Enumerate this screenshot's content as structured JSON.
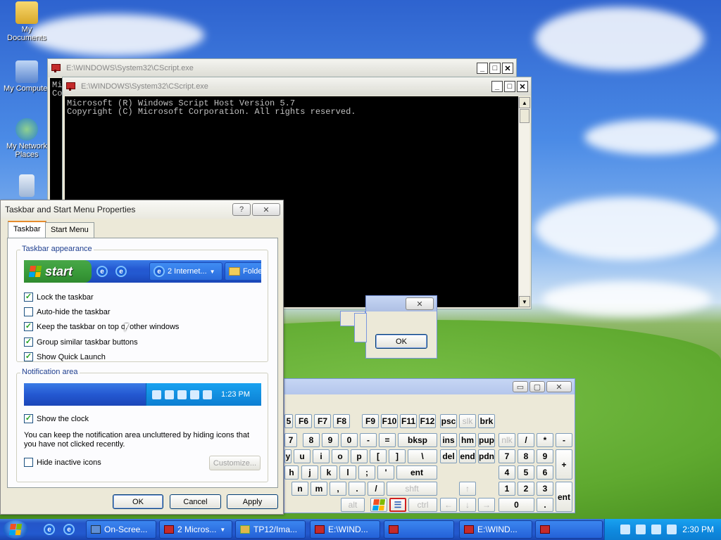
{
  "desktop": {
    "icons": [
      {
        "label": "My Documents"
      },
      {
        "label": "My Computer"
      },
      {
        "label": "My Network Places"
      },
      {
        "label": ""
      }
    ]
  },
  "console_back": {
    "title": "E:\\WINDOWS\\System32\\CScript.exe",
    "peek_text": "Mi\nCo"
  },
  "console_front": {
    "title": "E:\\WINDOWS\\System32\\CScript.exe",
    "lines": "Microsoft (R) Windows Script Host Version 5.7\nCopyright (C) Microsoft Corporation. All rights reserved."
  },
  "dialog": {
    "title": "Taskbar and Start Menu Properties",
    "help_glyph": "?",
    "close_glyph": "✕",
    "tabs": [
      "Taskbar",
      "Start Menu"
    ],
    "appearance": {
      "label": "Taskbar appearance",
      "preview_start": "start",
      "preview_item1": "2 Internet...",
      "preview_item2": "Folde",
      "options": [
        {
          "label": "Lock the taskbar",
          "checked": true
        },
        {
          "label": "Auto-hide the taskbar",
          "checked": false
        },
        {
          "label": "Keep the taskbar on top of other windows",
          "checked": true
        },
        {
          "label": "Group similar taskbar buttons",
          "checked": true
        },
        {
          "label": "Show Quick Launch",
          "checked": true
        }
      ]
    },
    "notification": {
      "label": "Notification area",
      "preview_clock": "1:23 PM",
      "show_clock": {
        "label": "Show the clock",
        "checked": true
      },
      "description": "You can keep the notification area uncluttered by hiding icons that you have not clicked recently.",
      "hide_inactive": {
        "label": "Hide inactive icons",
        "checked": false
      },
      "customize_label": "Customize..."
    },
    "buttons": {
      "ok": "OK",
      "cancel": "Cancel",
      "apply": "Apply"
    }
  },
  "mini_dialog": {
    "ok": "OK",
    "close_glyph": "✕"
  },
  "osk": {
    "title_buttons": [
      "▭",
      "▢",
      "✕"
    ],
    "rows": [
      [
        "5",
        "F6",
        "F7",
        "F8",
        "F9",
        "F10",
        "F11",
        "F12",
        "psc",
        "slk",
        "brk"
      ],
      [
        "7",
        "8",
        "9",
        "0",
        "-",
        "=",
        "bksp",
        "ins",
        "hm",
        "pup",
        "nlk",
        "/",
        "*",
        "-"
      ],
      [
        "y",
        "u",
        "i",
        "o",
        "p",
        "[",
        "]",
        "\\",
        "del",
        "end",
        "pdn",
        "7",
        "8",
        "9",
        "+"
      ],
      [
        "h",
        "j",
        "k",
        "l",
        ";",
        "'",
        "ent",
        "4",
        "5",
        "6"
      ],
      [
        "n",
        "m",
        ",",
        ".",
        "/",
        "shft",
        "↑",
        "1",
        "2",
        "3",
        "ent"
      ],
      [
        "alt",
        "",
        "",
        "ctrl",
        "←",
        "↓",
        "→",
        "0",
        "."
      ]
    ]
  },
  "taskbar": {
    "tasks": [
      {
        "label": "On-Scree..."
      },
      {
        "label": "2 Micros..."
      },
      {
        "label": "TP12/Ima..."
      },
      {
        "label": "E:\\WIND..."
      },
      {
        "label": ""
      },
      {
        "label": "E:\\WIND..."
      },
      {
        "label": ""
      }
    ],
    "clock": "2:30 PM"
  }
}
